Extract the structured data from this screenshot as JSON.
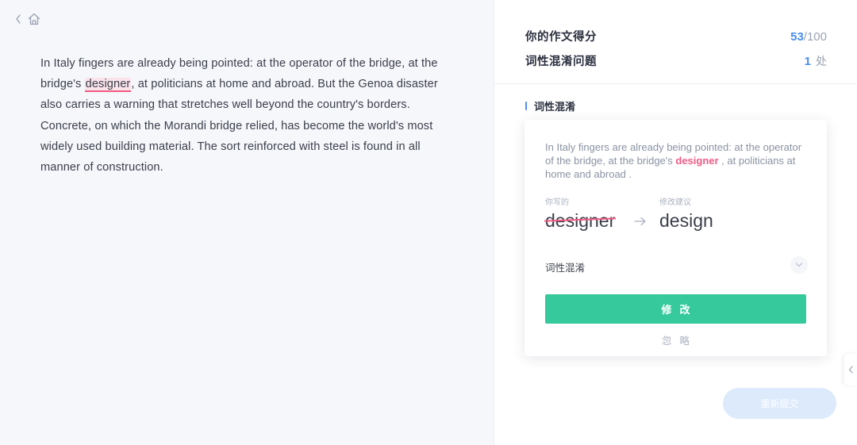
{
  "nav": {
    "back_icon": "chevron-left-icon",
    "home_icon": "home-icon"
  },
  "essay": {
    "before": "In Italy fingers are already being pointed: at the operator of the bridge, at the bridge's ",
    "highlight": "designer",
    "after": ", at politicians at home and abroad. But the Genoa disaster also carries a warning that stretches well beyond the country's borders. Concrete, on which the Morandi bridge relied, has become the world's most widely used building material. The sort reinforced with steel is found in all manner of construction."
  },
  "summary": {
    "score_label": "你的作文得分",
    "score": "53",
    "score_total": "/100",
    "issue_label": "词性混淆问题",
    "issue_count": "1",
    "issue_unit": "处"
  },
  "section": {
    "title": "词性混淆"
  },
  "card": {
    "context_before": "In Italy fingers are already being pointed: at the operator of the bridge, at the bridge's ",
    "context_keyword": "designer",
    "context_after": " , at politicians at home and abroad .",
    "original_caption": "你写的",
    "suggestion_caption": "修改建议",
    "original_word": "designer",
    "suggested_word": "design",
    "issue_type": "词性混淆",
    "fix_label": "修改",
    "ignore_label": "忽略"
  },
  "actions": {
    "resubmit_label": "重新提交"
  },
  "colors": {
    "accent": "#4b8ef1",
    "error": "#f25b84",
    "primary_button": "#36c99c",
    "disabled_button": "#dceafc"
  }
}
